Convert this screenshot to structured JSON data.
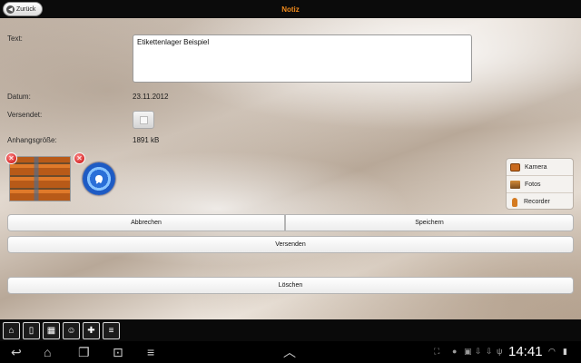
{
  "header": {
    "title": "Notiz",
    "back_label": "Zurück"
  },
  "form": {
    "text_label": "Text:",
    "text_value": "Etikettenlager Beispiel",
    "date_label": "Datum:",
    "date_value": "23.11.2012",
    "sent_label": "Versendet:",
    "sent_checked": false,
    "size_label": "Anhangsgröße:",
    "size_value": "1891 kB"
  },
  "media": {
    "camera": "Kamera",
    "photos": "Fotos",
    "recorder": "Recorder"
  },
  "buttons": {
    "cancel": "Abbrechen",
    "save": "Speichern",
    "send": "Versenden",
    "delete": "Löschen"
  },
  "system": {
    "clock": "14:41"
  },
  "icons": {
    "back": "arrow-left-icon",
    "delete_attachment": "red-x-icon",
    "audio_attachment": "music-disc-icon",
    "camera": "camera-icon",
    "photos": "photo-folder-icon",
    "recorder": "microphone-icon"
  },
  "colors": {
    "title": "#f08a1c",
    "bars": "#0b0b0b",
    "delete_badge": "#c40000"
  }
}
